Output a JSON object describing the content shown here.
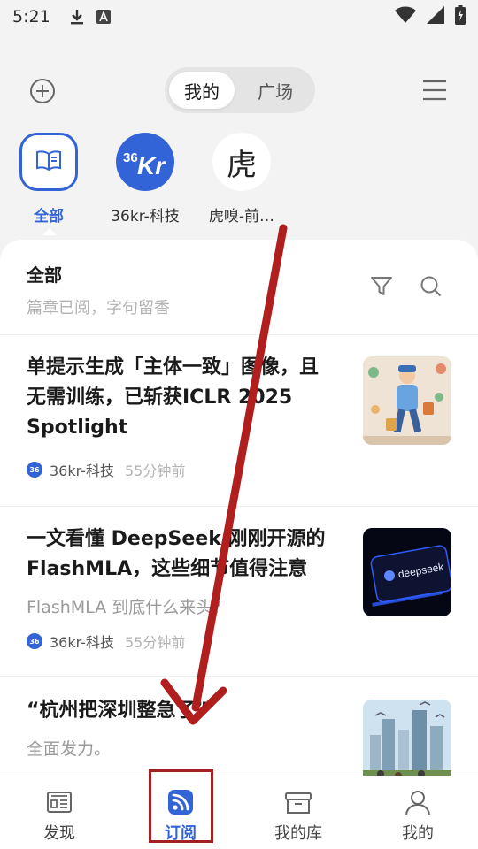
{
  "statusbar": {
    "time": "5:21"
  },
  "header": {
    "tabs": [
      {
        "label": "我的",
        "active": true
      },
      {
        "label": "广场",
        "active": false
      }
    ]
  },
  "sources": [
    {
      "label": "全部",
      "icon": "book-icon",
      "active": true
    },
    {
      "label": "36kr-科技",
      "icon": "36kr-logo"
    },
    {
      "label": "虎嗅-前…",
      "icon": "huxiu-logo",
      "logo_text": "虎"
    }
  ],
  "panel": {
    "title": "全部",
    "subtitle": "篇章已阅，字句留香"
  },
  "articles": [
    {
      "title": "单提示生成「主体一致」图像，且无需训练，已斩获ICLR 2025 Spotlight",
      "summary": "",
      "source": "36kr-科技",
      "time": "55分钟前"
    },
    {
      "title": "一文看懂 DeepSeek 刚刚开源的 FlashMLA，这些细节值得注意",
      "summary": "FlashMLA 到底什么来头?",
      "source": "36kr-科技",
      "time": "55分钟前",
      "thumb_text": "deepseek"
    },
    {
      "title": "“杭州把深圳整急了”",
      "summary": "全面发力。",
      "source": "",
      "time": ""
    }
  ],
  "bottom_nav": [
    {
      "label": "发现",
      "icon": "newspaper-icon"
    },
    {
      "label": "订阅",
      "icon": "rss-icon",
      "active": true
    },
    {
      "label": "我的库",
      "icon": "archive-box-icon"
    },
    {
      "label": "我的",
      "icon": "user-icon"
    }
  ],
  "colors": {
    "accent": "#3364d7",
    "annotation": "#a32121"
  }
}
